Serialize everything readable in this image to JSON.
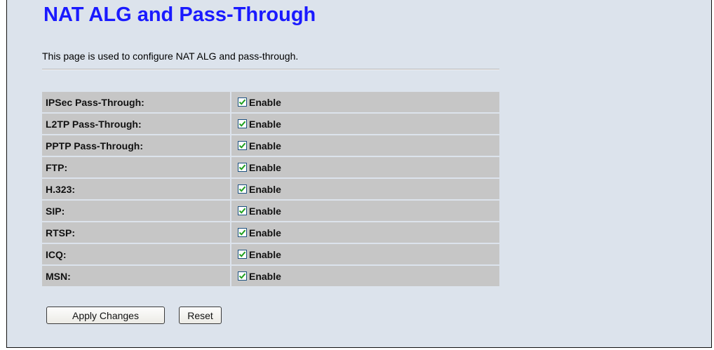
{
  "page": {
    "title": "NAT ALG and Pass-Through",
    "description": "This page is used to configure NAT ALG and pass-through."
  },
  "options": [
    {
      "label": "IPSec Pass-Through:",
      "checkbox_label": "Enable",
      "checked": true
    },
    {
      "label": "L2TP Pass-Through:",
      "checkbox_label": "Enable",
      "checked": true
    },
    {
      "label": "PPTP Pass-Through:",
      "checkbox_label": "Enable",
      "checked": true
    },
    {
      "label": "FTP:",
      "checkbox_label": "Enable",
      "checked": true
    },
    {
      "label": "H.323:",
      "checkbox_label": "Enable",
      "checked": true
    },
    {
      "label": "SIP:",
      "checkbox_label": "Enable",
      "checked": true
    },
    {
      "label": "RTSP:",
      "checkbox_label": "Enable",
      "checked": true
    },
    {
      "label": "ICQ:",
      "checkbox_label": "Enable",
      "checked": true
    },
    {
      "label": "MSN:",
      "checkbox_label": "Enable",
      "checked": true
    }
  ],
  "buttons": {
    "apply_label": "Apply Changes",
    "reset_label": "Reset"
  },
  "colors": {
    "title": "#1a1aff",
    "background": "#dce3ec",
    "row": "#c6c6c6",
    "checkmark": "#21a121"
  }
}
